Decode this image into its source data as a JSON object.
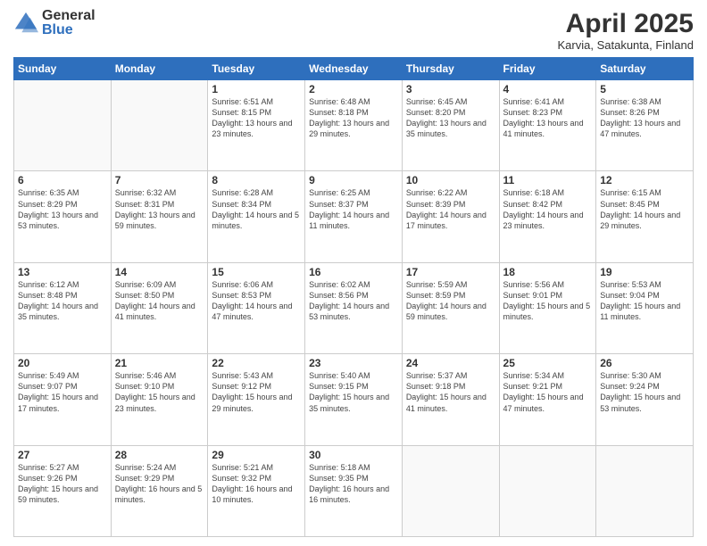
{
  "logo": {
    "general": "General",
    "blue": "Blue"
  },
  "header": {
    "month": "April 2025",
    "location": "Karvia, Satakunta, Finland"
  },
  "weekdays": [
    "Sunday",
    "Monday",
    "Tuesday",
    "Wednesday",
    "Thursday",
    "Friday",
    "Saturday"
  ],
  "weeks": [
    [
      {
        "day": "",
        "sunrise": "",
        "sunset": "",
        "daylight": ""
      },
      {
        "day": "",
        "sunrise": "",
        "sunset": "",
        "daylight": ""
      },
      {
        "day": "1",
        "sunrise": "Sunrise: 6:51 AM",
        "sunset": "Sunset: 8:15 PM",
        "daylight": "Daylight: 13 hours and 23 minutes."
      },
      {
        "day": "2",
        "sunrise": "Sunrise: 6:48 AM",
        "sunset": "Sunset: 8:18 PM",
        "daylight": "Daylight: 13 hours and 29 minutes."
      },
      {
        "day": "3",
        "sunrise": "Sunrise: 6:45 AM",
        "sunset": "Sunset: 8:20 PM",
        "daylight": "Daylight: 13 hours and 35 minutes."
      },
      {
        "day": "4",
        "sunrise": "Sunrise: 6:41 AM",
        "sunset": "Sunset: 8:23 PM",
        "daylight": "Daylight: 13 hours and 41 minutes."
      },
      {
        "day": "5",
        "sunrise": "Sunrise: 6:38 AM",
        "sunset": "Sunset: 8:26 PM",
        "daylight": "Daylight: 13 hours and 47 minutes."
      }
    ],
    [
      {
        "day": "6",
        "sunrise": "Sunrise: 6:35 AM",
        "sunset": "Sunset: 8:29 PM",
        "daylight": "Daylight: 13 hours and 53 minutes."
      },
      {
        "day": "7",
        "sunrise": "Sunrise: 6:32 AM",
        "sunset": "Sunset: 8:31 PM",
        "daylight": "Daylight: 13 hours and 59 minutes."
      },
      {
        "day": "8",
        "sunrise": "Sunrise: 6:28 AM",
        "sunset": "Sunset: 8:34 PM",
        "daylight": "Daylight: 14 hours and 5 minutes."
      },
      {
        "day": "9",
        "sunrise": "Sunrise: 6:25 AM",
        "sunset": "Sunset: 8:37 PM",
        "daylight": "Daylight: 14 hours and 11 minutes."
      },
      {
        "day": "10",
        "sunrise": "Sunrise: 6:22 AM",
        "sunset": "Sunset: 8:39 PM",
        "daylight": "Daylight: 14 hours and 17 minutes."
      },
      {
        "day": "11",
        "sunrise": "Sunrise: 6:18 AM",
        "sunset": "Sunset: 8:42 PM",
        "daylight": "Daylight: 14 hours and 23 minutes."
      },
      {
        "day": "12",
        "sunrise": "Sunrise: 6:15 AM",
        "sunset": "Sunset: 8:45 PM",
        "daylight": "Daylight: 14 hours and 29 minutes."
      }
    ],
    [
      {
        "day": "13",
        "sunrise": "Sunrise: 6:12 AM",
        "sunset": "Sunset: 8:48 PM",
        "daylight": "Daylight: 14 hours and 35 minutes."
      },
      {
        "day": "14",
        "sunrise": "Sunrise: 6:09 AM",
        "sunset": "Sunset: 8:50 PM",
        "daylight": "Daylight: 14 hours and 41 minutes."
      },
      {
        "day": "15",
        "sunrise": "Sunrise: 6:06 AM",
        "sunset": "Sunset: 8:53 PM",
        "daylight": "Daylight: 14 hours and 47 minutes."
      },
      {
        "day": "16",
        "sunrise": "Sunrise: 6:02 AM",
        "sunset": "Sunset: 8:56 PM",
        "daylight": "Daylight: 14 hours and 53 minutes."
      },
      {
        "day": "17",
        "sunrise": "Sunrise: 5:59 AM",
        "sunset": "Sunset: 8:59 PM",
        "daylight": "Daylight: 14 hours and 59 minutes."
      },
      {
        "day": "18",
        "sunrise": "Sunrise: 5:56 AM",
        "sunset": "Sunset: 9:01 PM",
        "daylight": "Daylight: 15 hours and 5 minutes."
      },
      {
        "day": "19",
        "sunrise": "Sunrise: 5:53 AM",
        "sunset": "Sunset: 9:04 PM",
        "daylight": "Daylight: 15 hours and 11 minutes."
      }
    ],
    [
      {
        "day": "20",
        "sunrise": "Sunrise: 5:49 AM",
        "sunset": "Sunset: 9:07 PM",
        "daylight": "Daylight: 15 hours and 17 minutes."
      },
      {
        "day": "21",
        "sunrise": "Sunrise: 5:46 AM",
        "sunset": "Sunset: 9:10 PM",
        "daylight": "Daylight: 15 hours and 23 minutes."
      },
      {
        "day": "22",
        "sunrise": "Sunrise: 5:43 AM",
        "sunset": "Sunset: 9:12 PM",
        "daylight": "Daylight: 15 hours and 29 minutes."
      },
      {
        "day": "23",
        "sunrise": "Sunrise: 5:40 AM",
        "sunset": "Sunset: 9:15 PM",
        "daylight": "Daylight: 15 hours and 35 minutes."
      },
      {
        "day": "24",
        "sunrise": "Sunrise: 5:37 AM",
        "sunset": "Sunset: 9:18 PM",
        "daylight": "Daylight: 15 hours and 41 minutes."
      },
      {
        "day": "25",
        "sunrise": "Sunrise: 5:34 AM",
        "sunset": "Sunset: 9:21 PM",
        "daylight": "Daylight: 15 hours and 47 minutes."
      },
      {
        "day": "26",
        "sunrise": "Sunrise: 5:30 AM",
        "sunset": "Sunset: 9:24 PM",
        "daylight": "Daylight: 15 hours and 53 minutes."
      }
    ],
    [
      {
        "day": "27",
        "sunrise": "Sunrise: 5:27 AM",
        "sunset": "Sunset: 9:26 PM",
        "daylight": "Daylight: 15 hours and 59 minutes."
      },
      {
        "day": "28",
        "sunrise": "Sunrise: 5:24 AM",
        "sunset": "Sunset: 9:29 PM",
        "daylight": "Daylight: 16 hours and 5 minutes."
      },
      {
        "day": "29",
        "sunrise": "Sunrise: 5:21 AM",
        "sunset": "Sunset: 9:32 PM",
        "daylight": "Daylight: 16 hours and 10 minutes."
      },
      {
        "day": "30",
        "sunrise": "Sunrise: 5:18 AM",
        "sunset": "Sunset: 9:35 PM",
        "daylight": "Daylight: 16 hours and 16 minutes."
      },
      {
        "day": "",
        "sunrise": "",
        "sunset": "",
        "daylight": ""
      },
      {
        "day": "",
        "sunrise": "",
        "sunset": "",
        "daylight": ""
      },
      {
        "day": "",
        "sunrise": "",
        "sunset": "",
        "daylight": ""
      }
    ]
  ]
}
